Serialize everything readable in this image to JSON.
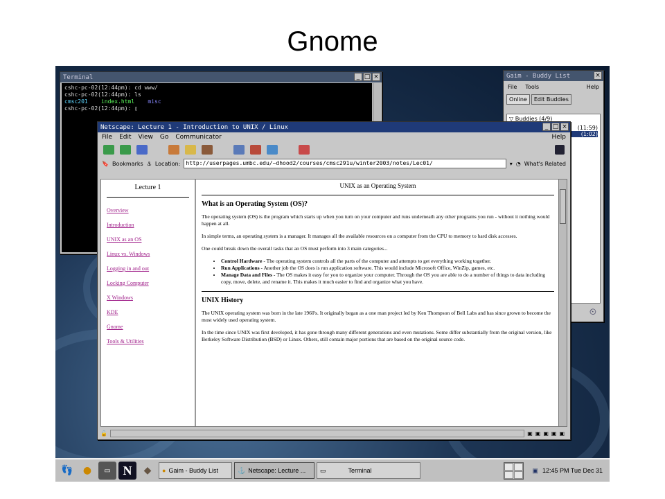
{
  "slide": {
    "title": "Gnome"
  },
  "terminal": {
    "title": "Terminal",
    "lines": [
      "cshc-pc-02(12:44pm): cd www/",
      "cshc-pc-02(12:44pm): ls"
    ],
    "ls_output": [
      "cmsc201",
      "index.html",
      "misc"
    ],
    "prompt": "cshc-pc-02(12:44pm): ▯"
  },
  "buddy": {
    "title": "Gaim - Buddy List",
    "menu": [
      "File",
      "Tools",
      "Help"
    ],
    "tabs": [
      "Online",
      "Edit Buddies"
    ],
    "group": "Buddies (4/9)",
    "times": [
      "(11:59)",
      "(1:02)"
    ]
  },
  "netscape": {
    "title": "Netscape: Lecture 1 - Introduction to UNIX / Linux",
    "menu": [
      "File",
      "Edit",
      "View",
      "Go",
      "Communicator"
    ],
    "menu_help": "Help",
    "bookmarks_label": "Bookmarks",
    "location_label": "Location:",
    "url": "http://userpages.umbc.edu/~dhood2/courses/cmsc291u/winter2003/notes/Lec01/",
    "whats_related": "What's Related",
    "left": {
      "title": "Lecture 1",
      "links": [
        "Overview",
        "Introduction",
        "UNIX as an OS",
        "Linux vs. Windows",
        "Logging in and out",
        "Locking Computer",
        "X Windows",
        "KDE",
        "Gnome",
        "Tools & Utilities"
      ]
    },
    "main": {
      "page_title": "UNIX as an Operating System",
      "h1": "What is an Operating System (OS)?",
      "p1": "The operating system (OS) is the program which starts up when you turn on your computer and runs underneath any other programs you run - without it nothing would happen at all.",
      "p2": "In simple terms, an operating system is a manager. It manages all the available resources on a computer from the CPU to memory to hard disk accesses.",
      "p3": "One could break down the overall tasks that an OS must perform into 3 main categories...",
      "bullets": [
        {
          "b": "Control Hardware",
          "t": " - The operating system controls all the parts of the computer and attempts to get everything working together."
        },
        {
          "b": "Run Applications",
          "t": " - Another job the OS does is run application software. This would include Microsoft Office, WinZip, games, etc."
        },
        {
          "b": "Manage Data and Files",
          "t": " - The OS makes it easy for you to organize your computer. Through the OS you are able to do a number of things to data including copy, move, delete, and rename it. This makes it much easier to find and organize what you have."
        }
      ],
      "h2": "UNIX History",
      "p4": "The UNIX operating system was born in the late 1960's. It originally began as a one man project led by Ken Thompson of Bell Labs and has since grown to become the most widely used operating system.",
      "p5": "In the time since UNIX was first developed, it has gone through many different generations and even mutations. Some differ substantially from the original version, like Berkeley Software Distribution (BSD) or Linux. Others, still contain major portions that are based on the original source code."
    }
  },
  "taskbar": {
    "tasks": [
      "Gaim - Buddy List",
      "Netscape: Lecture ...",
      "Terminal"
    ],
    "clock": "12:45 PM Tue Dec 31"
  },
  "colors": {
    "titlebar_active": "#1f3a78",
    "link": "#a0208a",
    "desktop": "#1d3554"
  }
}
